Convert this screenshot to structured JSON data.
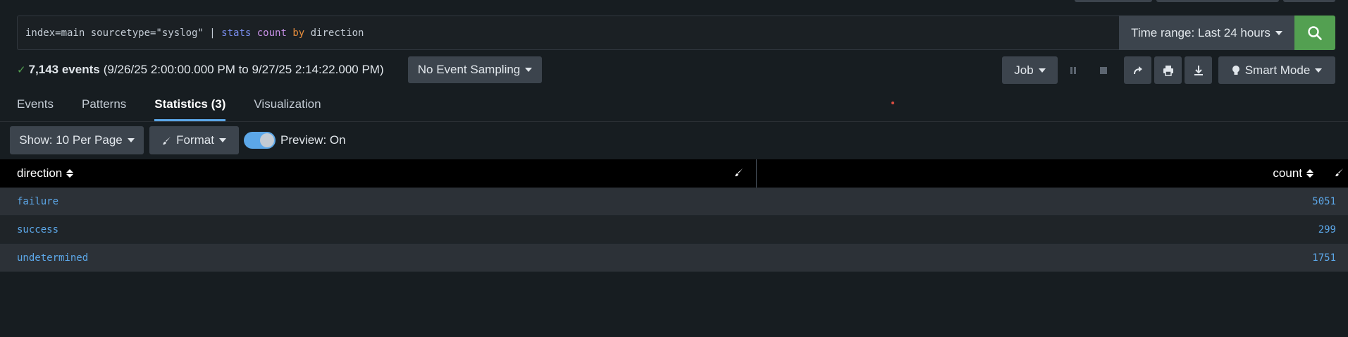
{
  "search": {
    "query_parts": [
      "index=main sourcetype=\"syslog\" | ",
      "stats",
      " ",
      "count",
      " ",
      "by",
      " direction"
    ],
    "time_range_label": "Time range: Last 24 hours",
    "search_icon": "magnifier-icon"
  },
  "status": {
    "event_count": "7,143 events",
    "range": "(9/26/25 2:00:00.000 PM to 9/27/25 2:14:22.000 PM)",
    "sampling_label": "No Event Sampling"
  },
  "job_controls": {
    "job_label": "Job",
    "smart_mode_label": "Smart Mode"
  },
  "tabs": [
    {
      "label": "Events"
    },
    {
      "label": "Patterns"
    },
    {
      "label": "Statistics (3)"
    },
    {
      "label": "Visualization"
    }
  ],
  "toolbar": {
    "show_label": "Show: 10 Per Page",
    "format_label": "Format",
    "preview_label": "Preview: On"
  },
  "table": {
    "columns": [
      "direction",
      "count"
    ],
    "rows": [
      {
        "direction": "failure",
        "count": "5051"
      },
      {
        "direction": "success",
        "count": "299"
      },
      {
        "direction": "undetermined",
        "count": "1751"
      }
    ]
  },
  "colors": {
    "accent": "#5ca7e8",
    "search_button": "#53a051",
    "button_bg": "#3c444d",
    "page_bg": "#171d21"
  }
}
